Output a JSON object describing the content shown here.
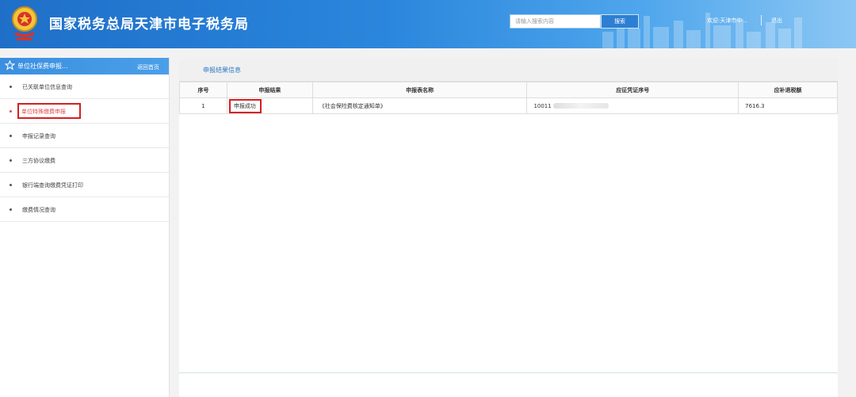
{
  "header": {
    "title": "国家税务总局天津市电子税务局",
    "search_placeholder": "请输入搜索内容",
    "search_button": "搜索",
    "welcome": "欢迎:天津市中...",
    "logout": "退出"
  },
  "sidebar": {
    "title": "单位社保费申报...",
    "home_link": "返回首页",
    "items": [
      {
        "label": "已关联单位信息查询"
      },
      {
        "label": "单位特殊缴费申报",
        "active": true
      },
      {
        "label": "申报记录查询"
      },
      {
        "label": "三方协议缴费"
      },
      {
        "label": "银行端查询缴费凭证打印"
      },
      {
        "label": "缴费情况查询"
      }
    ]
  },
  "main": {
    "section_title": "申报结果信息",
    "table": {
      "headers": [
        "序号",
        "申报结果",
        "申报表名称",
        "应征凭证序号",
        "应补退税额"
      ],
      "rows": [
        {
          "index": "1",
          "result": "申报成功",
          "form_name": "《社会保险费核定通知单》",
          "voucher_no": "10011",
          "amount": "7616.3"
        }
      ]
    }
  },
  "colors": {
    "header_blue": "#2a86dc",
    "accent_blue": "#2c78c8",
    "highlight_red": "#d32020"
  },
  "icons": [
    "tax-emblem-icon",
    "star-icon"
  ]
}
